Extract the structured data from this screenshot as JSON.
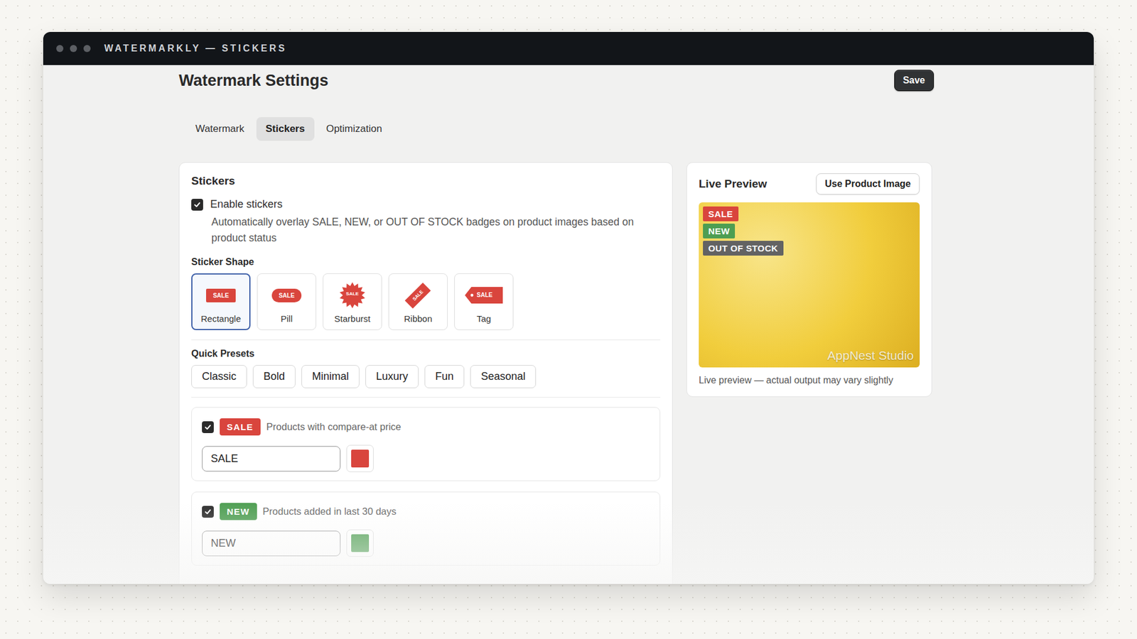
{
  "window": {
    "title": "WATERMARKLY — STICKERS"
  },
  "page": {
    "title": "Watermark Settings",
    "save": "Save"
  },
  "tabs": [
    {
      "label": "Watermark",
      "selected": false
    },
    {
      "label": "Stickers",
      "selected": true
    },
    {
      "label": "Optimization",
      "selected": false
    }
  ],
  "stickers": {
    "title": "Stickers",
    "enable": {
      "label": "Enable stickers",
      "checked": true,
      "description": "Automatically overlay SALE, NEW, or OUT OF STOCK badges on product images based on product status"
    },
    "shape": {
      "label": "Sticker Shape",
      "items": [
        {
          "label": "Rectangle",
          "preview": "SALE",
          "kind": "rectangle",
          "selected": true
        },
        {
          "label": "Pill",
          "preview": "SALE",
          "kind": "pill",
          "selected": false
        },
        {
          "label": "Starburst",
          "preview": "SALE",
          "kind": "starburst",
          "selected": false
        },
        {
          "label": "Ribbon",
          "preview": "SALE",
          "kind": "ribbon",
          "selected": false
        },
        {
          "label": "Tag",
          "preview": "SALE",
          "kind": "tag",
          "selected": false
        }
      ]
    },
    "presets": {
      "label": "Quick Presets",
      "items": [
        "Classic",
        "Bold",
        "Minimal",
        "Luxury",
        "Fun",
        "Seasonal"
      ]
    },
    "rows": [
      {
        "badge": "SALE",
        "description": "Products with compare-at price",
        "value": "SALE",
        "checked": true,
        "color": "#d9453d"
      },
      {
        "badge": "NEW",
        "description": "Products added in last 30 days",
        "value": "NEW",
        "checked": true,
        "color": "#4e9e52"
      }
    ]
  },
  "preview": {
    "title": "Live Preview",
    "button": "Use Product Image",
    "badges": [
      {
        "text": "SALE",
        "color": "#d9453d"
      },
      {
        "text": "NEW",
        "color": "#4e9e52"
      },
      {
        "text": "OUT OF STOCK",
        "color": "#636363"
      }
    ],
    "watermark": "AppNest Studio",
    "caption": "Live preview — actual output may vary slightly"
  }
}
